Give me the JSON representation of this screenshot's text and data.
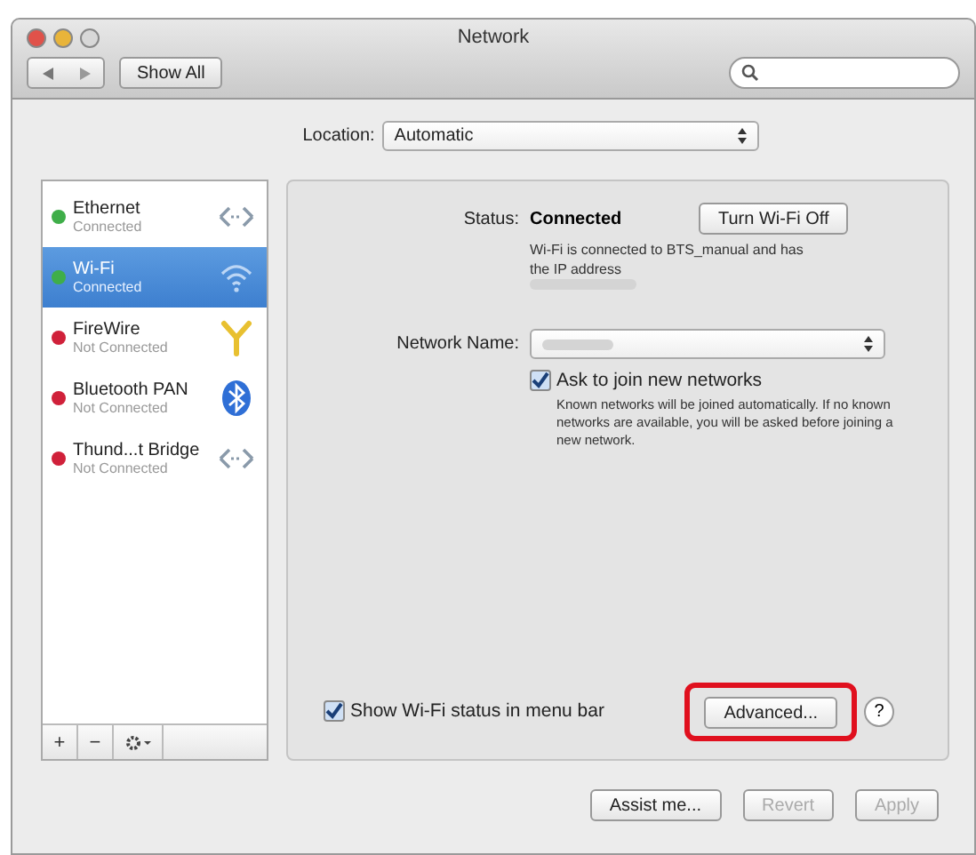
{
  "window": {
    "title": "Network",
    "toolbar": {
      "show_all": "Show All"
    }
  },
  "location": {
    "label": "Location:",
    "value": "Automatic"
  },
  "services": [
    {
      "name": "Ethernet",
      "status": "Connected",
      "selected": false,
      "color": "#3fae49",
      "kind": "ethernet"
    },
    {
      "name": "Wi-Fi",
      "status": "Connected",
      "selected": true,
      "color": "#3fae49",
      "kind": "wifi"
    },
    {
      "name": "FireWire",
      "status": "Not Connected",
      "selected": false,
      "color": "#d0213a",
      "kind": "firewire"
    },
    {
      "name": "Bluetooth PAN",
      "status": "Not Connected",
      "selected": false,
      "color": "#d0213a",
      "kind": "bluetooth"
    },
    {
      "name": "Thund...t Bridge",
      "status": "Not Connected",
      "selected": false,
      "color": "#d0213a",
      "kind": "ethernet"
    }
  ],
  "list_buttons": [
    "+",
    "−"
  ],
  "detail": {
    "status_label": "Status:",
    "status_value": "Connected",
    "toggle_button": "Turn Wi-Fi Off",
    "status_note": "Wi-Fi is connected to BTS_manual and has the IP address",
    "network_label": "Network Name:",
    "ask_join": {
      "label": "Ask to join new networks",
      "checked": true,
      "note": "Known networks will be joined automatically. If no known networks are available, you will be asked before joining a new network."
    },
    "show_status": {
      "label": "Show Wi-Fi status in menu bar",
      "checked": true
    },
    "advanced": {
      "label": "Advanced...",
      "highlighted": true
    },
    "help": "?"
  },
  "footer_buttons": [
    {
      "label": "Assist me...",
      "disabled": false
    },
    {
      "label": "Revert",
      "disabled": true
    },
    {
      "label": "Apply",
      "disabled": true
    }
  ]
}
